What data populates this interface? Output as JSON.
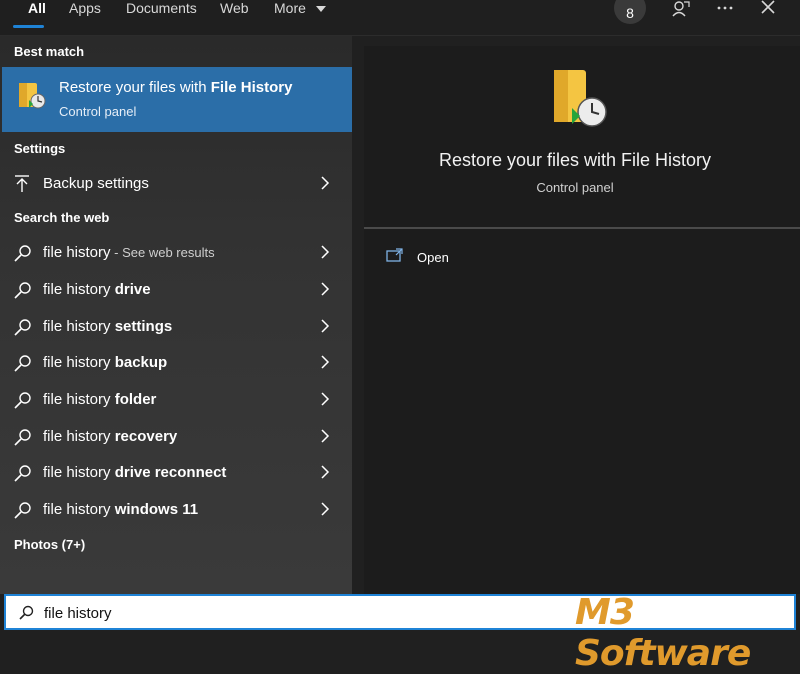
{
  "tabs": [
    {
      "label": "All",
      "active": true
    },
    {
      "label": "Apps"
    },
    {
      "label": "Documents"
    },
    {
      "label": "Web"
    },
    {
      "label": "More"
    }
  ],
  "badge": "8",
  "left": {
    "best_match_header": "Best match",
    "best_match": {
      "title_prefix": "Restore your files with ",
      "title_bold": "File History",
      "subtitle": "Control panel",
      "icon": "file-history-folder-icon"
    },
    "settings_header": "Settings",
    "settings_items": [
      {
        "label": "Backup settings",
        "icon": "backup-arrow-icon"
      }
    ],
    "web_header": "Search the web",
    "web_items": [
      {
        "prefix": "file history",
        "bold": "",
        "hint": " - See web results"
      },
      {
        "prefix": "file history ",
        "bold": "drive",
        "hint": ""
      },
      {
        "prefix": "file history ",
        "bold": "settings",
        "hint": ""
      },
      {
        "prefix": "file history ",
        "bold": "backup",
        "hint": ""
      },
      {
        "prefix": "file history ",
        "bold": "folder",
        "hint": ""
      },
      {
        "prefix": "file history ",
        "bold": "recovery",
        "hint": ""
      },
      {
        "prefix": "file history ",
        "bold": "drive reconnect",
        "hint": ""
      },
      {
        "prefix": "file history ",
        "bold": "windows 11",
        "hint": ""
      }
    ],
    "photos_header": "Photos (7+)"
  },
  "preview": {
    "title": "Restore your files with File History",
    "subtitle": "Control panel",
    "actions": [
      {
        "label": "Open",
        "icon": "open-window-icon"
      }
    ]
  },
  "search": {
    "value": "file history"
  },
  "watermark": "M3 Software",
  "colors": {
    "accent": "#1f83d6",
    "selected": "#2b6ea8",
    "watermark": "#e09a2c"
  }
}
